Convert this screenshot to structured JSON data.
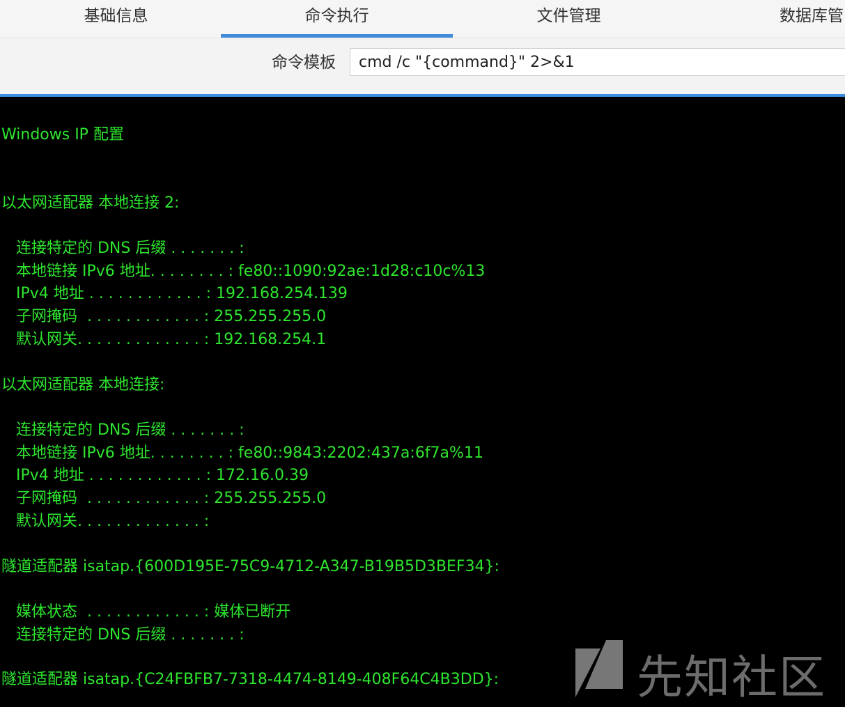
{
  "tabs": [
    {
      "label": "基础信息"
    },
    {
      "label": "命令执行"
    },
    {
      "label": "文件管理"
    },
    {
      "label": "数据库管"
    }
  ],
  "toolbar": {
    "template_label": "命令模板",
    "template_value": "cmd /c \"{command}\" 2>&1"
  },
  "terminal": {
    "lines": [
      "Windows IP 配置",
      "以太网适配器 本地连接 2:",
      "   连接特定的 DNS 后缀 . . . . . . . :",
      "   本地链接 IPv6 地址. . . . . . . . : fe80::1090:92ae:1d28:c10c%13",
      "   IPv4 地址 . . . . . . . . . . . . : 192.168.254.139",
      "   子网掩码  . . . . . . . . . . . . : 255.255.255.0",
      "   默认网关. . . . . . . . . . . . . : 192.168.254.1",
      "以太网适配器 本地连接:",
      "   连接特定的 DNS 后缀 . . . . . . . :",
      "   本地链接 IPv6 地址. . . . . . . . : fe80::9843:2202:437a:6f7a%11",
      "   IPv4 地址 . . . . . . . . . . . . : 172.16.0.39",
      "   子网掩码  . . . . . . . . . . . . : 255.255.255.0",
      "   默认网关. . . . . . . . . . . . . :",
      "隧道适配器 isatap.{600D195E-75C9-4712-A347-B19B5D3BEF34}:",
      "   媒体状态  . . . . . . . . . . . . : 媒体已断开",
      "   连接特定的 DNS 后缀 . . . . . . . :",
      "隧道适配器 isatap.{C24FBFB7-7318-4474-8149-408F64C4B3DD}:"
    ]
  },
  "watermark": {
    "text": "先知社区",
    "logo_icon": "xianzhi-logo-icon"
  },
  "colors": {
    "terminal_text": "#2ee62e",
    "terminal_bg": "#000000",
    "accent": "#3b8ee0"
  }
}
